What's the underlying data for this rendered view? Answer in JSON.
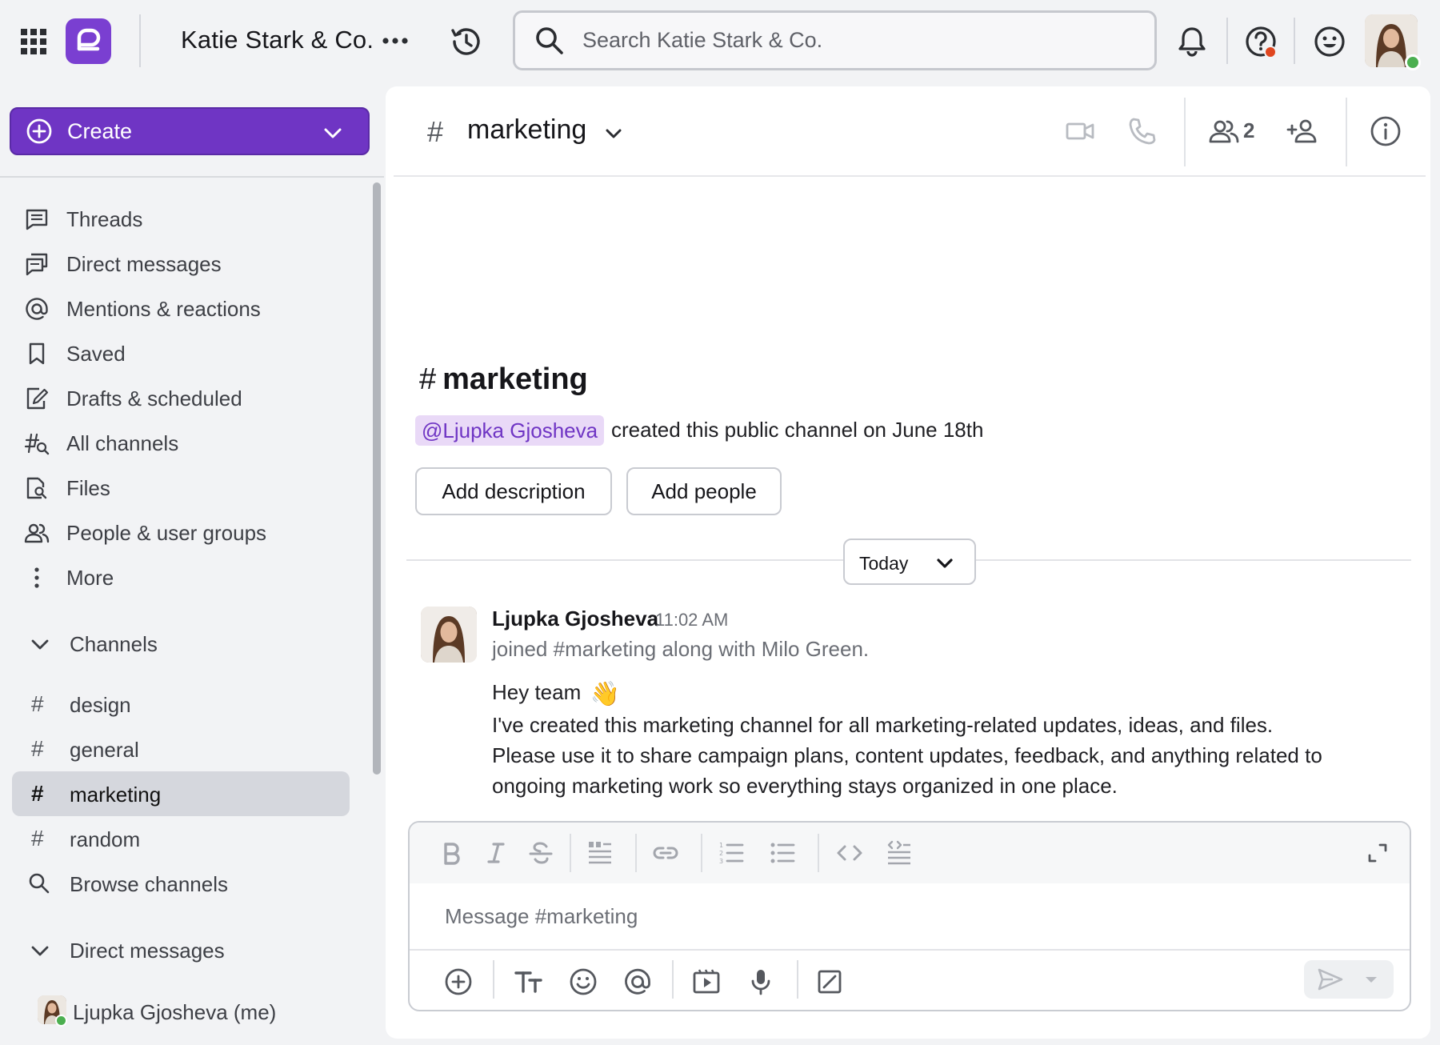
{
  "workspace": {
    "name": "Katie Stark & Co."
  },
  "search": {
    "placeholder": "Search Katie Stark & Co."
  },
  "sidebar": {
    "create_label": "Create",
    "nav": [
      {
        "label": "Threads",
        "icon": "threads-icon"
      },
      {
        "label": "Direct messages",
        "icon": "direct-messages-icon"
      },
      {
        "label": "Mentions & reactions",
        "icon": "at-icon"
      },
      {
        "label": "Saved",
        "icon": "bookmark-icon"
      },
      {
        "label": "Drafts & scheduled",
        "icon": "draft-icon"
      },
      {
        "label": "All channels",
        "icon": "channel-search-icon"
      },
      {
        "label": "Files",
        "icon": "file-search-icon"
      },
      {
        "label": "People & user groups",
        "icon": "people-icon"
      },
      {
        "label": "More",
        "icon": "more-vertical-icon"
      }
    ],
    "channels_header": "Channels",
    "channels": [
      "design",
      "general",
      "marketing",
      "random"
    ],
    "active_channel": "marketing",
    "browse_channels": "Browse channels",
    "dm_header": "Direct messages",
    "dms": [
      {
        "label": "Ljupka Gjosheva (me)"
      }
    ]
  },
  "channel": {
    "name": "marketing",
    "hash": "#",
    "member_count": "2"
  },
  "intro": {
    "title": "marketing",
    "mention": "@Ljupka Gjosheva",
    "text": "created this public channel on June 18th",
    "add_description": "Add description",
    "add_people": "Add people"
  },
  "divider": {
    "label": "Today"
  },
  "message": {
    "author": "Ljupka Gjosheva",
    "time": "11:02 AM",
    "system": "joined #marketing along with Milo Green.",
    "greeting": "Hey team",
    "emoji": "👋",
    "line1": "I've created this marketing channel for all marketing-related updates, ideas, and files.",
    "line2": "Please use it to share campaign plans, content updates, feedback, and anything related to ongoing marketing work so everything stays organized in one place."
  },
  "composer": {
    "placeholder": "Message #marketing"
  },
  "colors": {
    "accent": "#6f35c4",
    "mention_bg": "#e9d9f7",
    "presence": "#4caf50",
    "alert": "#e0461f"
  }
}
